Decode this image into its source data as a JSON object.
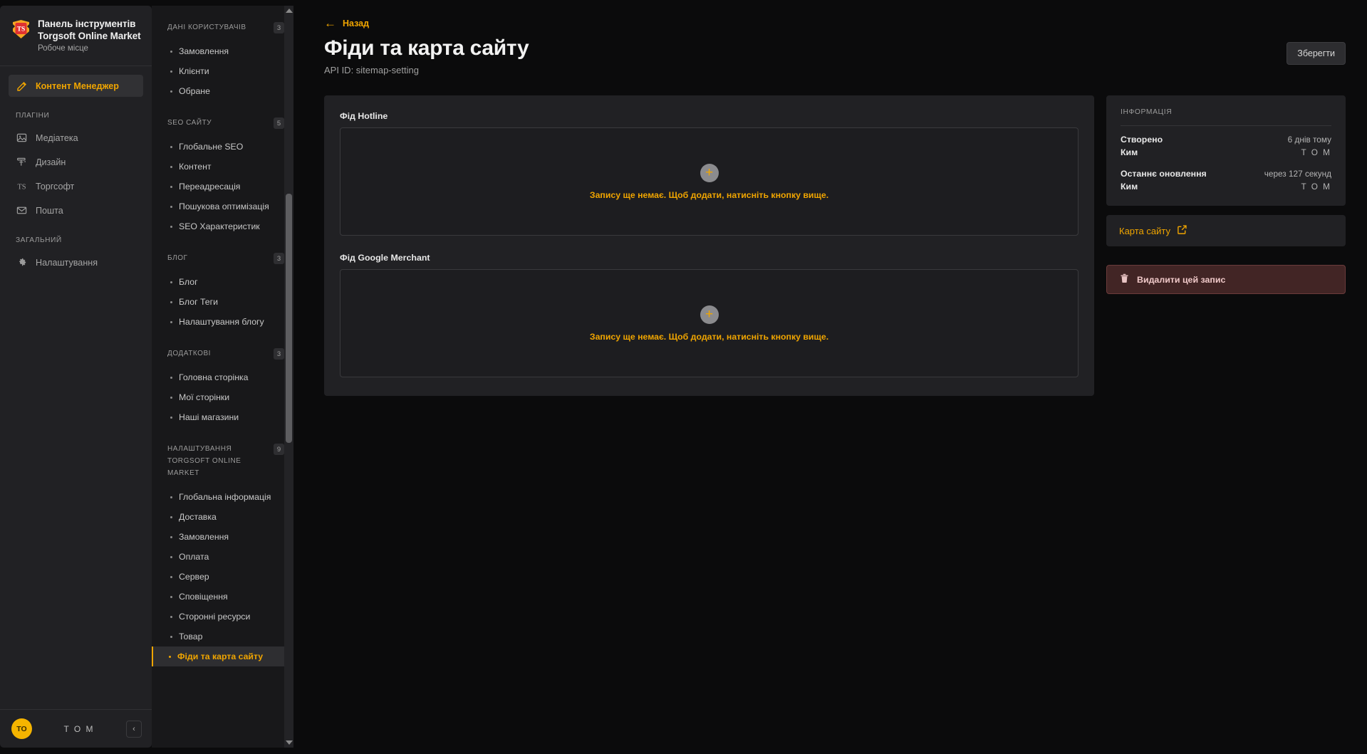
{
  "brand": {
    "logo_icon": "torgsoft-shield-logo",
    "title_line1": "Панель інструментів",
    "title_line2": "Torgsoft Online Market",
    "subtitle": "Робоче місце"
  },
  "primary_nav": {
    "active_item": {
      "label": "Контент Менеджер",
      "icon": "pencil-square-icon"
    },
    "groups": [
      {
        "label": "ПЛАГІНИ",
        "items": [
          {
            "label": "Медіатека",
            "icon": "image-icon"
          },
          {
            "label": "Дизайн",
            "icon": "paint-roller-icon"
          },
          {
            "label": "Торгсофт",
            "icon": "ts-logo-icon"
          },
          {
            "label": "Пошта",
            "icon": "envelope-icon"
          }
        ]
      },
      {
        "label": "ЗАГАЛЬНИЙ",
        "items": [
          {
            "label": "Налаштування",
            "icon": "gear-icon"
          }
        ]
      }
    ]
  },
  "secondary_nav": {
    "sections": [
      {
        "title": "ДАНІ КОРИСТУВАЧІВ",
        "badge": "3",
        "links": [
          "Замовлення",
          "Клієнти",
          "Обране"
        ]
      },
      {
        "title": "SEO САЙТУ",
        "badge": "5",
        "links": [
          "Глобальне SEO",
          "Контент",
          "Переадресація",
          "Пошукова оптимізація",
          "SEO Характеристик"
        ]
      },
      {
        "title": "БЛОГ",
        "badge": "3",
        "links": [
          "Блог",
          "Блог Теги",
          "Налаштування блогу"
        ]
      },
      {
        "title": "ДОДАТКОВІ",
        "badge": "3",
        "links": [
          "Головна сторінка",
          "Мої сторінки",
          "Наші магазини"
        ]
      },
      {
        "title": "НАЛАШТУВАННЯ TORGSOFT ONLINE MARKET",
        "badge": "9",
        "links": [
          "Глобальна інформація",
          "Доставка",
          "Замовлення",
          "Оплата",
          "Сервер",
          "Сповіщення",
          "Сторонні ресурси",
          "Товар",
          "Фіди та карта сайту"
        ],
        "active_link": "Фіди та карта сайту"
      }
    ]
  },
  "user_bar": {
    "avatar_initials": "TO",
    "user_name": "T O M",
    "collapse_icon": "chevron-left-icon"
  },
  "header": {
    "back_label": "Назад",
    "back_icon": "arrow-left-icon",
    "title": "Фіди та карта сайту",
    "api_id": "API ID: sitemap-setting",
    "save_label": "Зберегти"
  },
  "main": {
    "fields": [
      {
        "label": "Фід Hotline",
        "empty_text": "Запису ще немає. Щоб додати, натисніть кнопку вище.",
        "add_icon": "plus-icon"
      },
      {
        "label": "Фід Google Merchant",
        "empty_text": "Запису ще немає. Щоб додати, натисніть кнопку вище.",
        "add_icon": "plus-icon"
      }
    ]
  },
  "side_panel": {
    "info_title": "ІНФОРМАЦІЯ",
    "rows": [
      {
        "key": "Створено",
        "value": "6 днів тому"
      },
      {
        "key": "Ким",
        "value": "T O M"
      },
      {
        "key": "Останнє оновлення",
        "value": "через 127 секунд"
      },
      {
        "key": "Ким",
        "value": "T O M"
      }
    ],
    "sitemap_link": "Карта сайту",
    "sitemap_icon": "external-link-icon",
    "delete_label": "Видалити цей запис",
    "delete_icon": "trash-icon"
  },
  "colors": {
    "accent": "#f0a500",
    "panel": "#212124",
    "secondary_panel": "#18181a",
    "background": "#0b0b0c",
    "danger": "#422525"
  }
}
